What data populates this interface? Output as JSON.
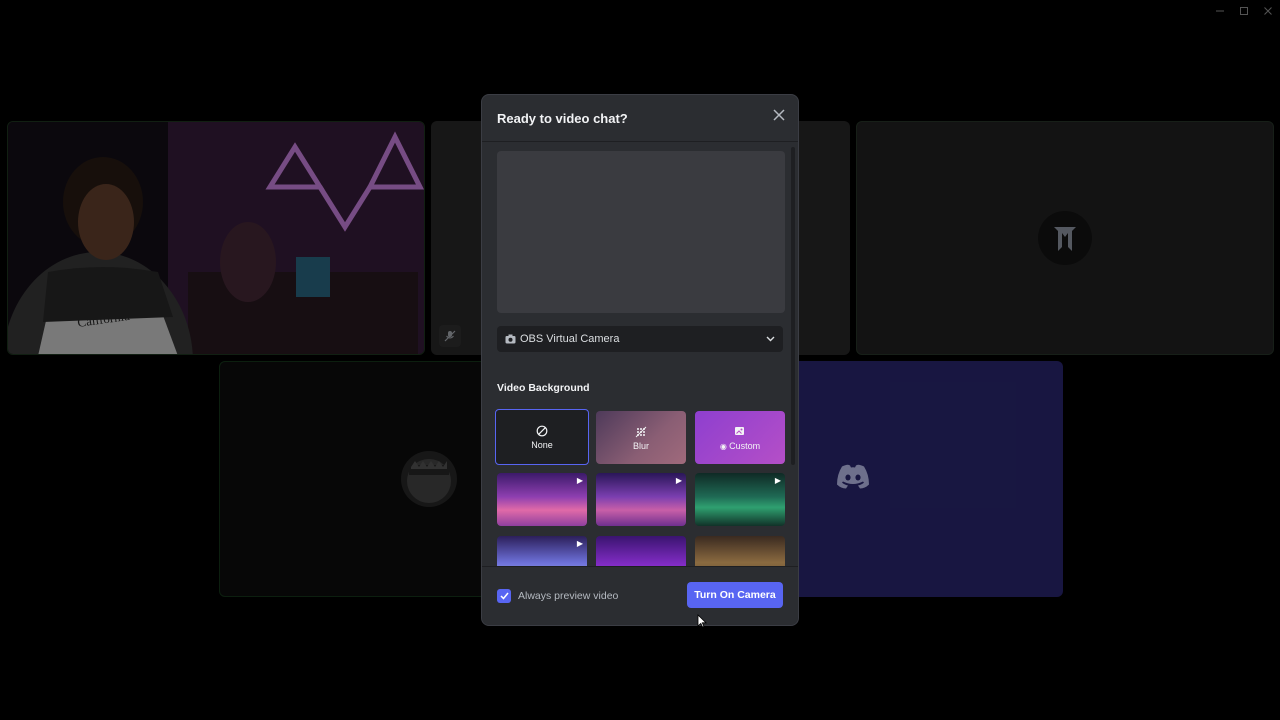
{
  "window_controls": {
    "minimize_icon": "minimize-icon",
    "maximize_icon": "maximize-icon",
    "close_icon": "close-icon"
  },
  "tiles": [
    {
      "name": "participant-tile-streamer",
      "muted": false
    },
    {
      "name": "participant-tile-muted",
      "muted": true,
      "icon": "mic-off-icon"
    },
    {
      "name": "participant-tile-logo",
      "icon": "server-logo-icon"
    },
    {
      "name": "participant-tile-avatar",
      "icon": "avatar-icon"
    },
    {
      "name": "participant-tile-discord",
      "icon": "discord-icon"
    }
  ],
  "modal": {
    "title": "Ready to video chat?",
    "camera_select": {
      "selected": "OBS Virtual Camera",
      "icon": "camera-icon"
    },
    "section_label": "Video Background",
    "options": [
      {
        "label": "None",
        "icon": "none-icon",
        "selected": true
      },
      {
        "label": "Blur",
        "icon": "blur-icon",
        "selected": false
      },
      {
        "label": "Custom",
        "icon": "custom-icon",
        "selected": false
      }
    ],
    "thumbnails": [
      {
        "animated": true
      },
      {
        "animated": true
      },
      {
        "animated": true
      },
      {
        "animated": true
      },
      {
        "animated": false
      },
      {
        "animated": false
      }
    ],
    "footer": {
      "checkbox_label": "Always preview video",
      "checkbox_checked": true,
      "primary_button": "Turn On Camera"
    }
  },
  "colors": {
    "accent": "#5865f2",
    "modal_bg": "#2b2d31",
    "input_bg": "#1e1f22"
  }
}
